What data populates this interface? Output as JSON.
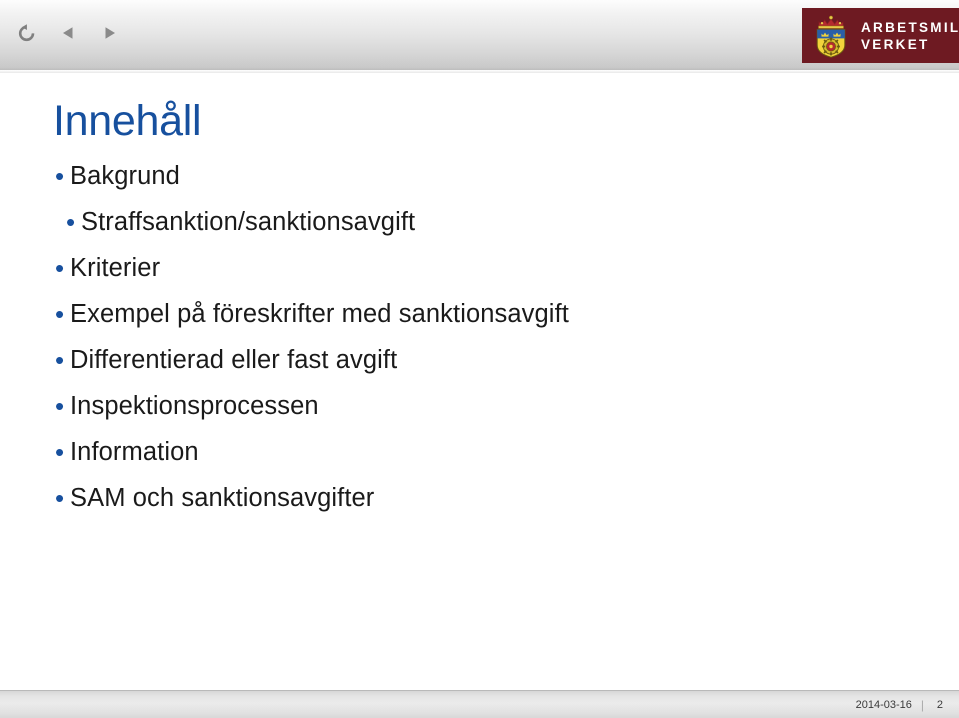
{
  "toolbar": {
    "buttons": [
      {
        "name": "reload-icon",
        "label": "Reload"
      },
      {
        "name": "previous-slide-icon",
        "label": "Previous"
      },
      {
        "name": "next-slide-icon",
        "label": "Next"
      }
    ]
  },
  "logo": {
    "line1": "ARBETSMILJÖ",
    "line2": "VERKET",
    "background_color": "#6e1a22",
    "icon": "swedish-coat-of-arms-icon"
  },
  "slide": {
    "title": "Innehåll",
    "title_color": "#17509e",
    "bullet_color": "#17509e",
    "body_color": "#1a1a1a",
    "bullet_glyph": "•",
    "bullets": [
      {
        "text": "Bakgrund",
        "indent": false
      },
      {
        "text": "Straffsanktion/sanktionsavgift",
        "indent": true
      },
      {
        "text": "Kriterier",
        "indent": false
      },
      {
        "text": "Exempel på föreskrifter med sanktionsavgift",
        "indent": false
      },
      {
        "text": "Differentierad eller fast avgift",
        "indent": false
      },
      {
        "text": "Inspektionsprocessen",
        "indent": false
      },
      {
        "text": "Information",
        "indent": false
      },
      {
        "text": "SAM och sanktionsavgifter",
        "indent": false
      }
    ]
  },
  "footer": {
    "date": "2014-03-16",
    "separator": "|",
    "page": "2"
  }
}
